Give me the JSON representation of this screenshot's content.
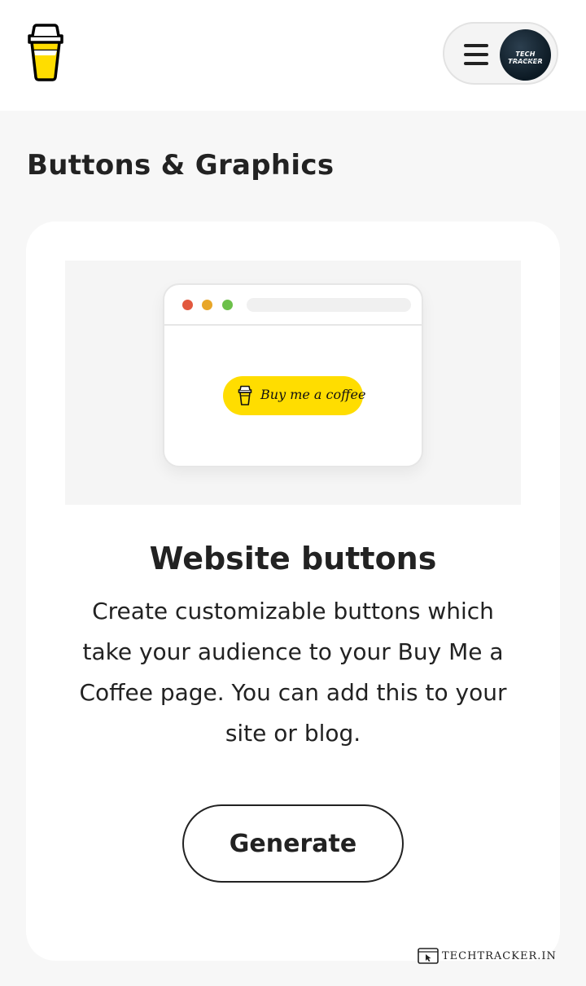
{
  "header": {
    "logo_icon": "coffee-cup-logo-icon",
    "menu_icon": "hamburger-menu-icon",
    "avatar_text": "TECH TRACKER"
  },
  "section": {
    "title": "Buttons & Graphics"
  },
  "card": {
    "illustration": {
      "window_dots": [
        "#e2583e",
        "#e8a628",
        "#6cc04a"
      ],
      "button_label": "Buy me a coffee",
      "button_color": "#ffdd00",
      "button_icon": "coffee-cup-icon"
    },
    "title": "Website buttons",
    "description": "Create customizable buttons which take your audience to your Buy Me a Coffee page. You can add this to your site or blog.",
    "generate_label": "Generate"
  },
  "watermark": {
    "text": "TECHTRACKER.IN",
    "icon": "browser-cursor-icon"
  },
  "colors": {
    "background": "#f7f7f7",
    "card": "#ffffff",
    "text": "#222222",
    "accent_yellow": "#ffdd00"
  }
}
